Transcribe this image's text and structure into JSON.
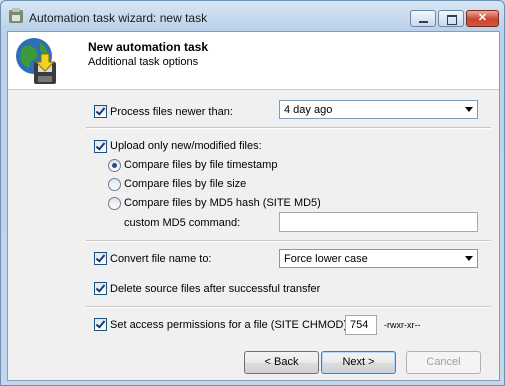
{
  "window": {
    "title": "Automation task wizard: new task",
    "controls": {
      "minimize": "minimize-icon",
      "maximize": "maximize-icon",
      "close": "close-icon"
    },
    "close_glyph": "✕"
  },
  "header": {
    "icon": "globe-download-icon",
    "title": "New automation task",
    "subtitle": "Additional task options"
  },
  "options": {
    "process_newer": {
      "label": "Process files newer than:",
      "checked": true,
      "value": "4 day ago"
    },
    "upload_new": {
      "label": "Upload only new/modified files:",
      "checked": true
    },
    "compare": [
      {
        "label": "Compare files by file timestamp",
        "selected": true
      },
      {
        "label": "Compare files by file size",
        "selected": false
      },
      {
        "label": "Compare files by MD5 hash (SITE MD5)",
        "selected": false
      }
    ],
    "md5_command": {
      "label": "custom MD5 command:",
      "value": ""
    },
    "convert_name": {
      "label": "Convert file name to:",
      "checked": true,
      "value": "Force lower case"
    },
    "delete_source": {
      "label": "Delete source files after successful transfer",
      "checked": true
    },
    "permissions": {
      "label": "Set access permissions for a file (SITE CHMOD)",
      "checked": true,
      "value": "754",
      "mask": "-rwxr-xr--"
    }
  },
  "buttons": {
    "back": "< Back",
    "next": "Next >",
    "cancel": "Cancel"
  }
}
